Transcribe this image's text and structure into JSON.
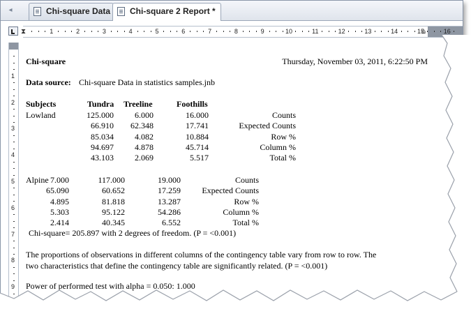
{
  "tabs": [
    {
      "label": "Chi-square Data",
      "icon": "datasheet-icon"
    },
    {
      "label": "Chi-square 2 Report *",
      "icon": "report-icon"
    }
  ],
  "ruler": {
    "h_numbers": [
      "1",
      "2",
      "3",
      "4",
      "5",
      "6",
      "7",
      "8",
      "9",
      "10",
      "11",
      "12",
      "13",
      "14",
      "15",
      "16"
    ],
    "v_numbers": [
      "1",
      "2",
      "3",
      "4",
      "5",
      "6",
      "7",
      "8",
      "9"
    ]
  },
  "report": {
    "title": "Chi-square",
    "datetime": "Thursday, November 03, 2011, 6:22:50 PM",
    "data_source_label": "Data source:",
    "data_source_value": "Chi-square Data in statistics samples.jnb",
    "headers": {
      "subjects": "Subjects",
      "tundra": "Tundra",
      "treeline": "Treeline",
      "foothills": "Foothills"
    },
    "lowland": {
      "name": "Lowland",
      "rows": [
        {
          "v": [
            "125.000",
            "6.000",
            "16.000"
          ],
          "label": "Counts"
        },
        {
          "v": [
            "66.910",
            "62.348",
            "17.741"
          ],
          "label": "Expected Counts"
        },
        {
          "v": [
            "85.034",
            "4.082",
            "10.884"
          ],
          "label": "Row %"
        },
        {
          "v": [
            "94.697",
            "4.878",
            "45.714"
          ],
          "label": "Column %"
        },
        {
          "v": [
            "43.103",
            "2.069",
            "5.517"
          ],
          "label": "Total %"
        }
      ]
    },
    "alpine": {
      "name": "Alpine",
      "rows": [
        {
          "v": [
            "7.000",
            "117.000",
            "19.000"
          ],
          "label": "Counts"
        },
        {
          "v": [
            "65.090",
            "60.652",
            "17.259"
          ],
          "label": "Expected Counts"
        },
        {
          "v": [
            "4.895",
            "81.818",
            "13.287"
          ],
          "label": "Row %"
        },
        {
          "v": [
            "5.303",
            "95.122",
            "54.286"
          ],
          "label": "Column %"
        },
        {
          "v": [
            "2.414",
            "40.345",
            "6.552"
          ],
          "label": "Total %"
        }
      ]
    },
    "chi_line": "Chi-square= 205.897 with 2 degrees of freedom. (P = <0.001)",
    "conclusion_1": "The proportions of observations in different columns of the contingency table vary from row to row.  The",
    "conclusion_2": "two characteristics that define the contingency table are significantly related. (P = <0.001)",
    "power_line": "Power of performed test with alpha = 0.050: 1.000"
  }
}
